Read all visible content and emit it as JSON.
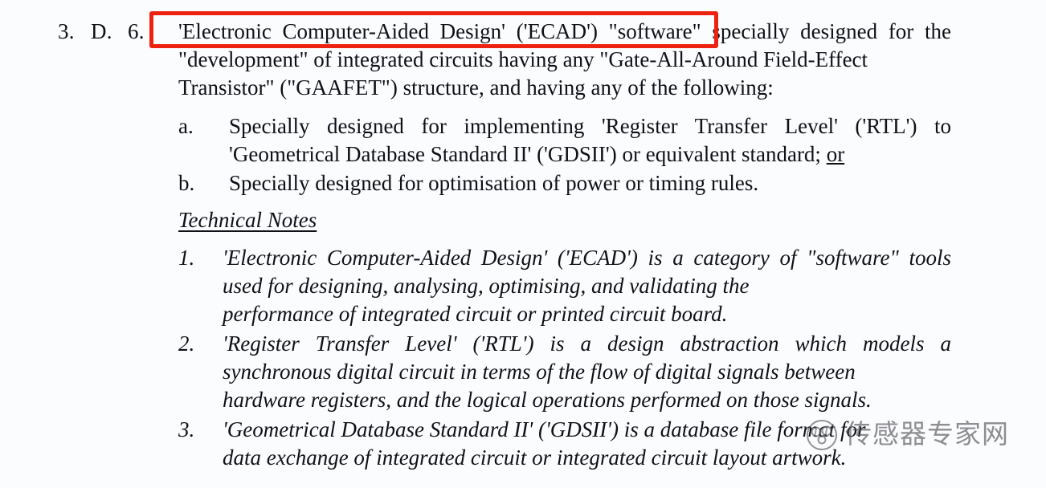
{
  "document": {
    "clause": {
      "number_parts": [
        "3.",
        "D.",
        "6."
      ],
      "highlighted_phrase": "'Electronic Computer-Aided Design' ('ECAD') \"software\"",
      "body_line1_rest": " specially designed for the",
      "body_line2": "\"development\" of integrated circuits having any \"Gate-All-Around Field-Effect",
      "body_line3": "Transistor\" (\"GAAFET\") structure, and having any of the following:",
      "highlight_color": "#ee2211"
    },
    "sub_items": [
      {
        "marker": "a.",
        "text_part1": "Specially designed for implementing 'Register Transfer Level' ('RTL') to 'Geometrical Database Standard II' ('GDSII') or equivalent standard; ",
        "text_underlined": "or"
      },
      {
        "marker": "b.",
        "text_part1": "Specially designed for optimisation of power or timing rules.",
        "text_underlined": ""
      }
    ],
    "technical_notes": {
      "heading": "Technical Notes",
      "items": [
        {
          "marker": "1.",
          "line1": "'Electronic Computer-Aided Design' ('ECAD') is a category of \"software\"",
          "line2": "tools used for designing, analysing, optimising, and validating the",
          "line3": "performance of integrated circuit or printed circuit board."
        },
        {
          "marker": "2.",
          "line1": "'Register Transfer Level' ('RTL') is a design abstraction which models a",
          "line2": "synchronous digital circuit in terms of the flow of digital signals between",
          "line3": "hardware registers, and the logical operations performed on those signals."
        },
        {
          "marker": "3.",
          "line1": "'Geometrical Database Standard II' ('GDSII') is a database file format for",
          "line2": "data exchange of integrated circuit or integrated circuit layout artwork.",
          "line3": ""
        }
      ]
    },
    "watermark": {
      "text": "传感器专家网",
      "logo_icon": "circular-dots-logo-icon",
      "color": "#4a4a52"
    }
  }
}
